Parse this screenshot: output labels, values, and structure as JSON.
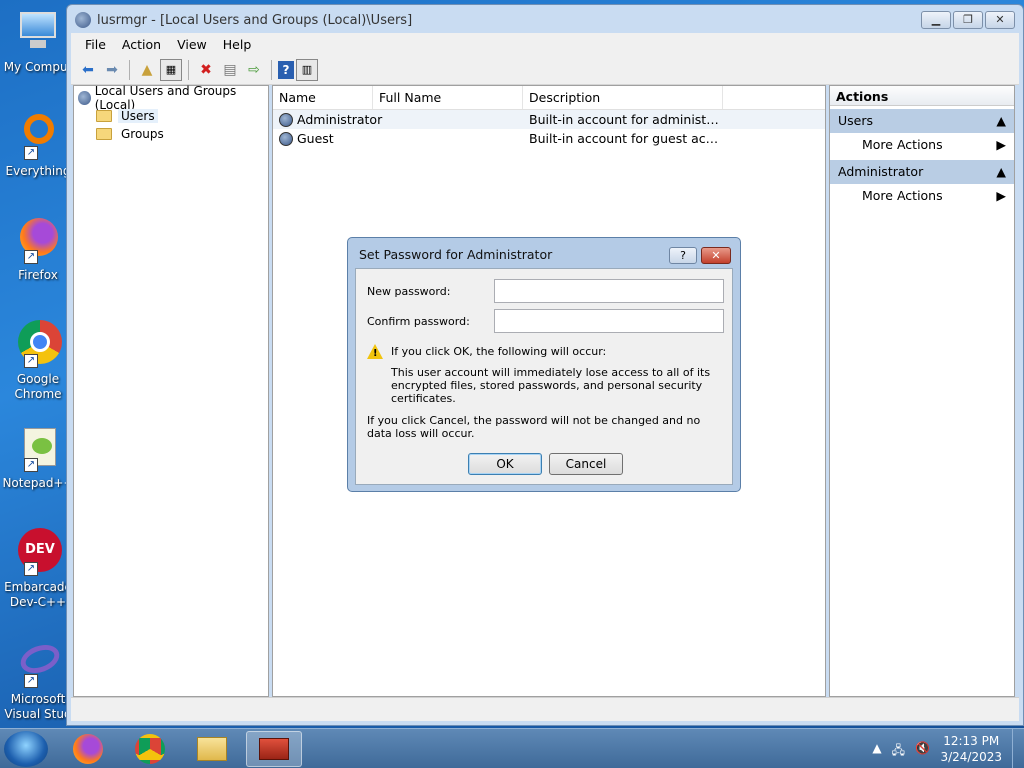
{
  "desktop": {
    "icons": [
      {
        "label": "My Comput"
      },
      {
        "label": "Everything"
      },
      {
        "label": "Firefox"
      },
      {
        "label": "Google\nChrome"
      },
      {
        "label": "Notepad++"
      },
      {
        "label": "Embarcade\nDev-C++"
      },
      {
        "label": "Microsoft\nVisual Stud"
      }
    ]
  },
  "window": {
    "title": "lusrmgr - [Local Users and Groups (Local)\\Users]",
    "menu": [
      "File",
      "Action",
      "View",
      "Help"
    ],
    "tree": {
      "root": "Local Users and Groups (Local)",
      "children": [
        "Users",
        "Groups"
      ]
    },
    "list": {
      "columns": [
        "Name",
        "Full Name",
        "Description"
      ],
      "rows": [
        {
          "name": "Administrator",
          "full_name": "",
          "description": "Built-in account for administering..."
        },
        {
          "name": "Guest",
          "full_name": "",
          "description": "Built-in account for guest access t..."
        }
      ]
    },
    "actions": {
      "title": "Actions",
      "sections": [
        {
          "label": "Users",
          "item": "More Actions"
        },
        {
          "label": "Administrator",
          "item": "More Actions"
        }
      ]
    }
  },
  "dialog": {
    "title": "Set Password for Administrator",
    "new_password_label": "New password:",
    "confirm_password_label": "Confirm password:",
    "new_password_value": "",
    "confirm_password_value": "",
    "warning_heading": "If you click OK, the following will occur:",
    "warning_body": "This user account will immediately lose access to all of its encrypted files, stored passwords, and personal security certificates.",
    "cancel_note": "If you click Cancel, the password will not be changed and no data loss will occur.",
    "ok_label": "OK",
    "cancel_label": "Cancel"
  },
  "taskbar": {
    "time": "12:13 PM",
    "date": "3/24/2023"
  }
}
